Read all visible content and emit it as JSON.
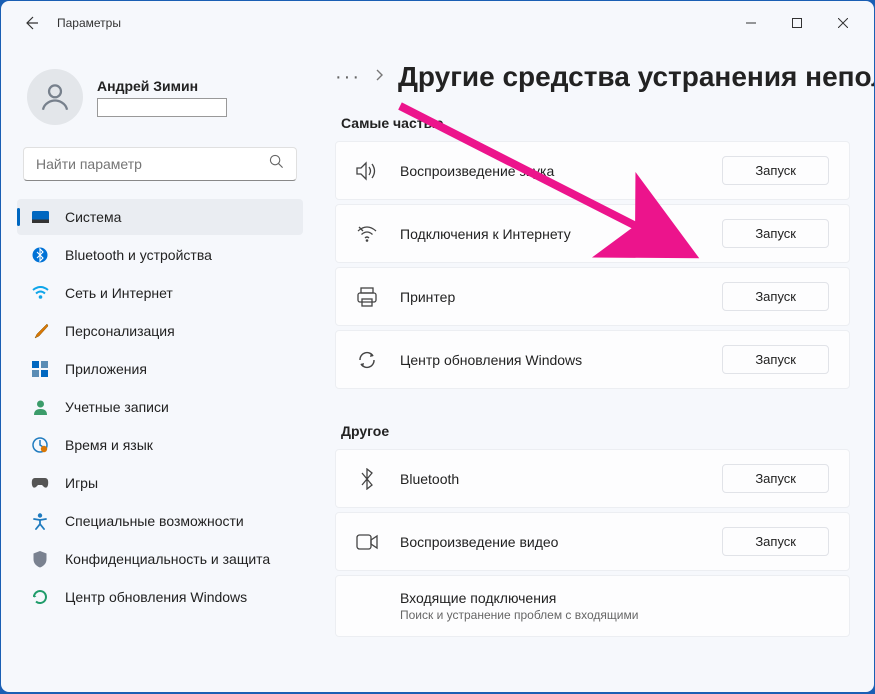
{
  "app_title": "Параметры",
  "user": {
    "name": "Андрей Зимин"
  },
  "search": {
    "placeholder": "Найти параметр"
  },
  "nav": {
    "items": [
      {
        "label": "Система"
      },
      {
        "label": "Bluetooth и устройства"
      },
      {
        "label": "Сеть и Интернет"
      },
      {
        "label": "Персонализация"
      },
      {
        "label": "Приложения"
      },
      {
        "label": "Учетные записи"
      },
      {
        "label": "Время и язык"
      },
      {
        "label": "Игры"
      },
      {
        "label": "Специальные возможности"
      },
      {
        "label": "Конфиденциальность и защита"
      },
      {
        "label": "Центр обновления Windows"
      }
    ]
  },
  "breadcrumb": {
    "ellipsis": "···",
    "title": "Другие средства устранения непол"
  },
  "sections": {
    "frequent": {
      "title": "Самые частые",
      "items": [
        {
          "label": "Воспроизведение звука",
          "button": "Запуск"
        },
        {
          "label": "Подключения к Интернету",
          "button": "Запуск"
        },
        {
          "label": "Принтер",
          "button": "Запуск"
        },
        {
          "label": "Центр обновления Windows",
          "button": "Запуск"
        }
      ]
    },
    "other": {
      "title": "Другое",
      "items": [
        {
          "label": "Bluetooth",
          "button": "Запуск"
        },
        {
          "label": "Воспроизведение видео",
          "button": "Запуск"
        },
        {
          "label": "Входящие подключения",
          "sub": "Поиск и устранение проблем с входящими"
        }
      ]
    }
  }
}
